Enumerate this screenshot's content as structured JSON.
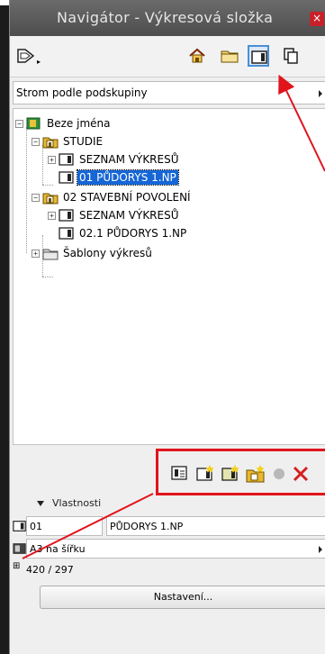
{
  "window": {
    "title": "Navigátor - Výkresová složka",
    "close_label": "×"
  },
  "toolbar": {
    "buttons": [
      {
        "icon": "publish-arrow-icon"
      },
      {
        "icon": "project-map-house-icon"
      },
      {
        "icon": "view-map-folder-icon"
      },
      {
        "icon": "layout-book-icon",
        "active": true
      },
      {
        "icon": "publisher-sets-icon"
      }
    ]
  },
  "view_selector": {
    "value": "Strom podle podskupiny"
  },
  "tree": {
    "items": [
      {
        "label": "Beze jména",
        "expander": "−"
      },
      {
        "label": "STUDIE",
        "expander": "−"
      },
      {
        "label": "SEZNAM VÝKRESŮ",
        "expander": "+"
      },
      {
        "label": "01 PŮDORYS 1.NP",
        "selected": true
      },
      {
        "label": "02 STAVEBNÍ POVOLENÍ",
        "expander": "−"
      },
      {
        "label": "SEZNAM VÝKRESŮ",
        "expander": "+"
      },
      {
        "label": "02.1 PŮDORYS 1.NP"
      },
      {
        "label": "Šablony výkresů",
        "expander": "+"
      }
    ]
  },
  "bottom_toolbar": {
    "buttons": [
      {
        "icon": "layout-settings-icon"
      },
      {
        "icon": "new-layout-icon"
      },
      {
        "icon": "new-master-layout-icon"
      },
      {
        "icon": "new-subset-icon"
      },
      {
        "icon": "record-dot-icon"
      },
      {
        "icon": "delete-x-icon"
      }
    ]
  },
  "properties": {
    "header": "Vlastnosti",
    "id_value": "01",
    "name_value": "PŮDORYS 1.NP",
    "master_value": "A3 na šířku",
    "size_value": "420 / 297",
    "settings_label": "Nastavení..."
  },
  "colors": {
    "accent_red": "#e1141c",
    "selection_blue": "#1666d6",
    "title_bar": "#5a5a5a"
  }
}
